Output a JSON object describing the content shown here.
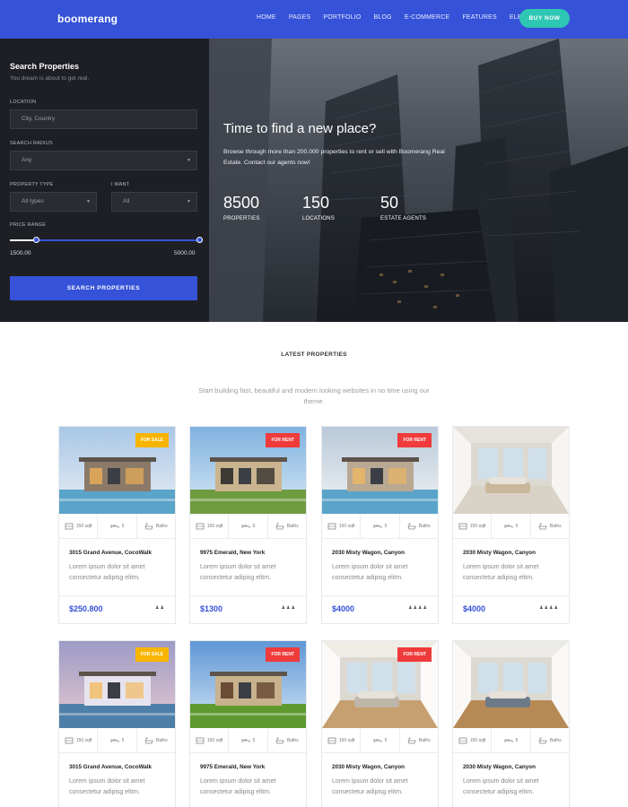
{
  "header": {
    "logo": "boomerang",
    "nav": [
      "HOME",
      "PAGES",
      "PORTFOLIO",
      "BLOG",
      "E-COMMERCE",
      "FEATURES",
      "ELEMENTS"
    ],
    "buy_label": "BUY NOW"
  },
  "search": {
    "title": "Search Properties",
    "subtitle": "You dream is about to get real.",
    "location_label": "LOCATION",
    "location_placeholder": "City, Country",
    "radius_label": "SEARCH RADIUS",
    "radius_value": "Any",
    "type_label": "PROPERTY TYPE",
    "type_value": "All types",
    "want_label": "I WANT",
    "want_value": "All",
    "price_label": "PRICE RANGE",
    "price_min": "1500.00",
    "price_max": "5000.00",
    "button": "SEARCH PROPERTIES"
  },
  "hero": {
    "heading": "Time to find a new place?",
    "text": "Browse through more than 200.000 properties to rent or sell with Boomerang Real Estate. Contact our agents now!",
    "stats": [
      {
        "value": "8500",
        "label": "PROPERTIES"
      },
      {
        "value": "150",
        "label": "LOCATIONS"
      },
      {
        "value": "50",
        "label": "ESTATE AGENTS"
      }
    ]
  },
  "section": {
    "title": "LATEST PROPERTIES",
    "subtitle": "Start building fast, beautiful and modern looking websites in no time using our theme."
  },
  "cards": [
    {
      "badge": "FOR SALE",
      "sqft": "150 sqft",
      "beds": "5",
      "baths": "Baths",
      "address": "3015 Grand Avenue, CocoWalk",
      "desc": "Lorem ipsum dolor sit amet consectetur adipisg elitm.",
      "price": "$250.800",
      "rating": "♟♟"
    },
    {
      "badge": "FOR RENT",
      "sqft": "150 sqft",
      "beds": "5",
      "baths": "Baths",
      "address": "9975 Emerald, New York",
      "desc": "Lorem ipsum dolor sit amet consectetur adipisg elitm.",
      "price": "$1300",
      "rating": "♟♟♟"
    },
    {
      "badge": "FOR RENT",
      "sqft": "150 sqft",
      "beds": "5",
      "baths": "Baths",
      "address": "2030 Misty Wagon, Canyon",
      "desc": "Lorem ipsum dolor sit amet consectetur adipisg elitm.",
      "price": "$4000",
      "rating": "♟♟♟♟"
    },
    {
      "badge": "",
      "sqft": "150 sqft",
      "beds": "5",
      "baths": "Baths",
      "address": "2030 Misty Wagon, Canyon",
      "desc": "Lorem ipsum dolor sit amet consectetur adipisg elitm.",
      "price": "$4000",
      "rating": "♟♟♟♟"
    },
    {
      "badge": "FOR SALE",
      "sqft": "150 sqft",
      "beds": "5",
      "baths": "Baths",
      "address": "3015 Grand Avenue, CocoWalk",
      "desc": "Lorem ipsum dolor sit amet consectetur adipisg elitm."
    },
    {
      "badge": "FOR RENT",
      "sqft": "150 sqft",
      "beds": "5",
      "baths": "Baths",
      "address": "9975 Emerald, New York",
      "desc": "Lorem ipsum dolor sit amet consectetur adipisg elitm."
    },
    {
      "badge": "FOR RENT",
      "sqft": "150 sqft",
      "beds": "5",
      "baths": "Baths",
      "address": "2030 Misty Wagon, Canyon",
      "desc": "Lorem ipsum dolor sit amet consectetur adipisg elitm."
    },
    {
      "badge": "",
      "sqft": "150 sqft",
      "beds": "5",
      "baths": "Baths",
      "address": "2030 Misty Wagon, Canyon",
      "desc": "Lorem ipsum dolor sit amet consectetur adipisg elitm."
    }
  ],
  "icons": {
    "area": "area-icon",
    "bed": "bed-icon",
    "bath": "bath-icon",
    "caret": "chevron-down-icon",
    "agent": "agent-icon"
  },
  "colors": {
    "brand": "#3552d8",
    "accent": "#2ec7b3",
    "sale": "#f7b500",
    "rent": "#ef3b3b",
    "panel": "#1e1f24"
  }
}
